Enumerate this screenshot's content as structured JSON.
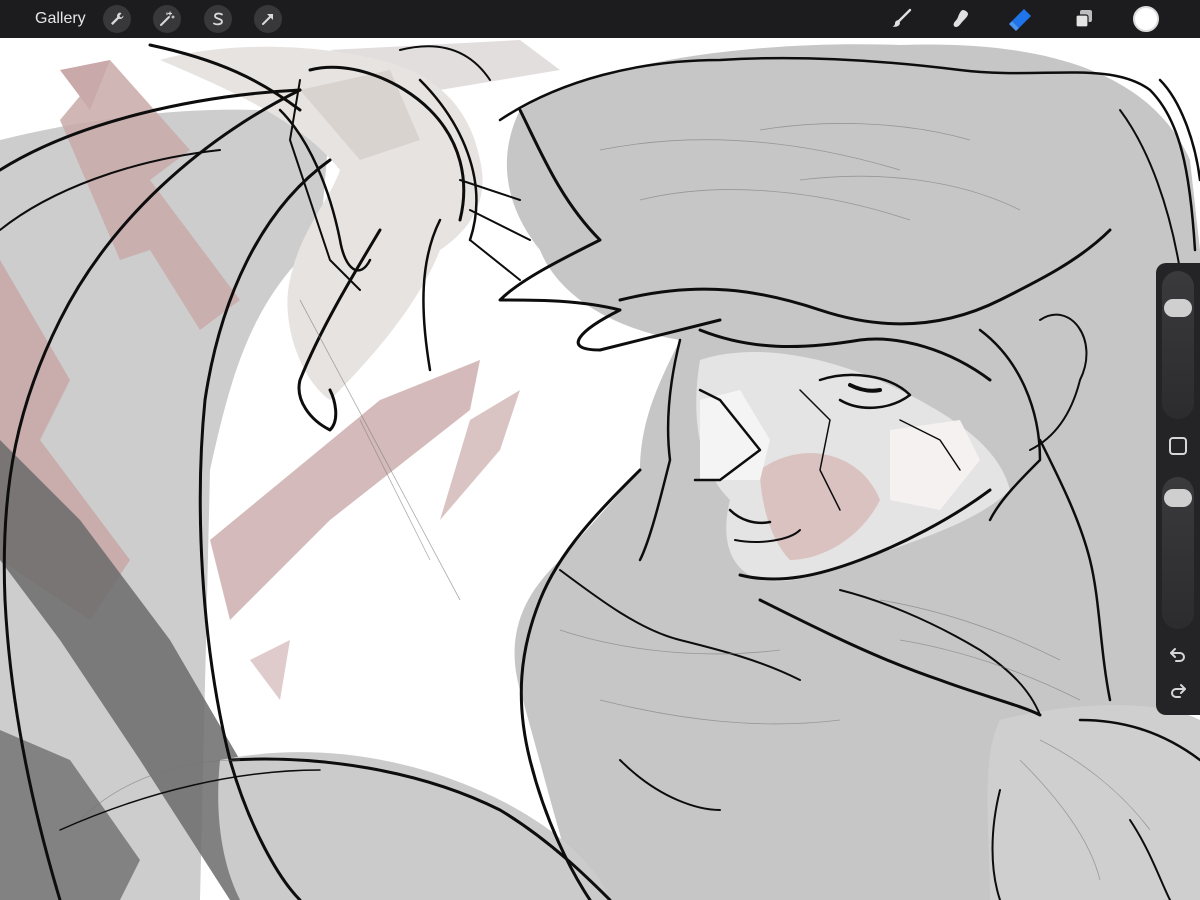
{
  "toolbar": {
    "gallery_label": "Gallery",
    "left_icons": [
      "wrench-icon",
      "magic-wand-icon",
      "selection-s-icon",
      "transform-arrow-icon"
    ],
    "right_icons": [
      "brush-icon",
      "smudge-icon",
      "eraser-icon",
      "layers-icon"
    ],
    "active_tool": "eraser",
    "active_color": "#ffffff",
    "accent_color": "#1e74e8"
  },
  "sidebar": {
    "brush_size_level": 0.2,
    "opacity_level": 0.06,
    "icons": [
      "modify-square-icon",
      "undo-icon",
      "redo-icon"
    ]
  },
  "canvas": {
    "artwork": "sketch-canvas",
    "colors": {
      "background": "#ffffff",
      "gray_fill": "#c9c9c9",
      "dark_gray": "#6b6b6b",
      "pink_stroke": "#c9a9a9",
      "light_hand": "#e6e4e2",
      "ink": "#0d0d0d"
    }
  }
}
